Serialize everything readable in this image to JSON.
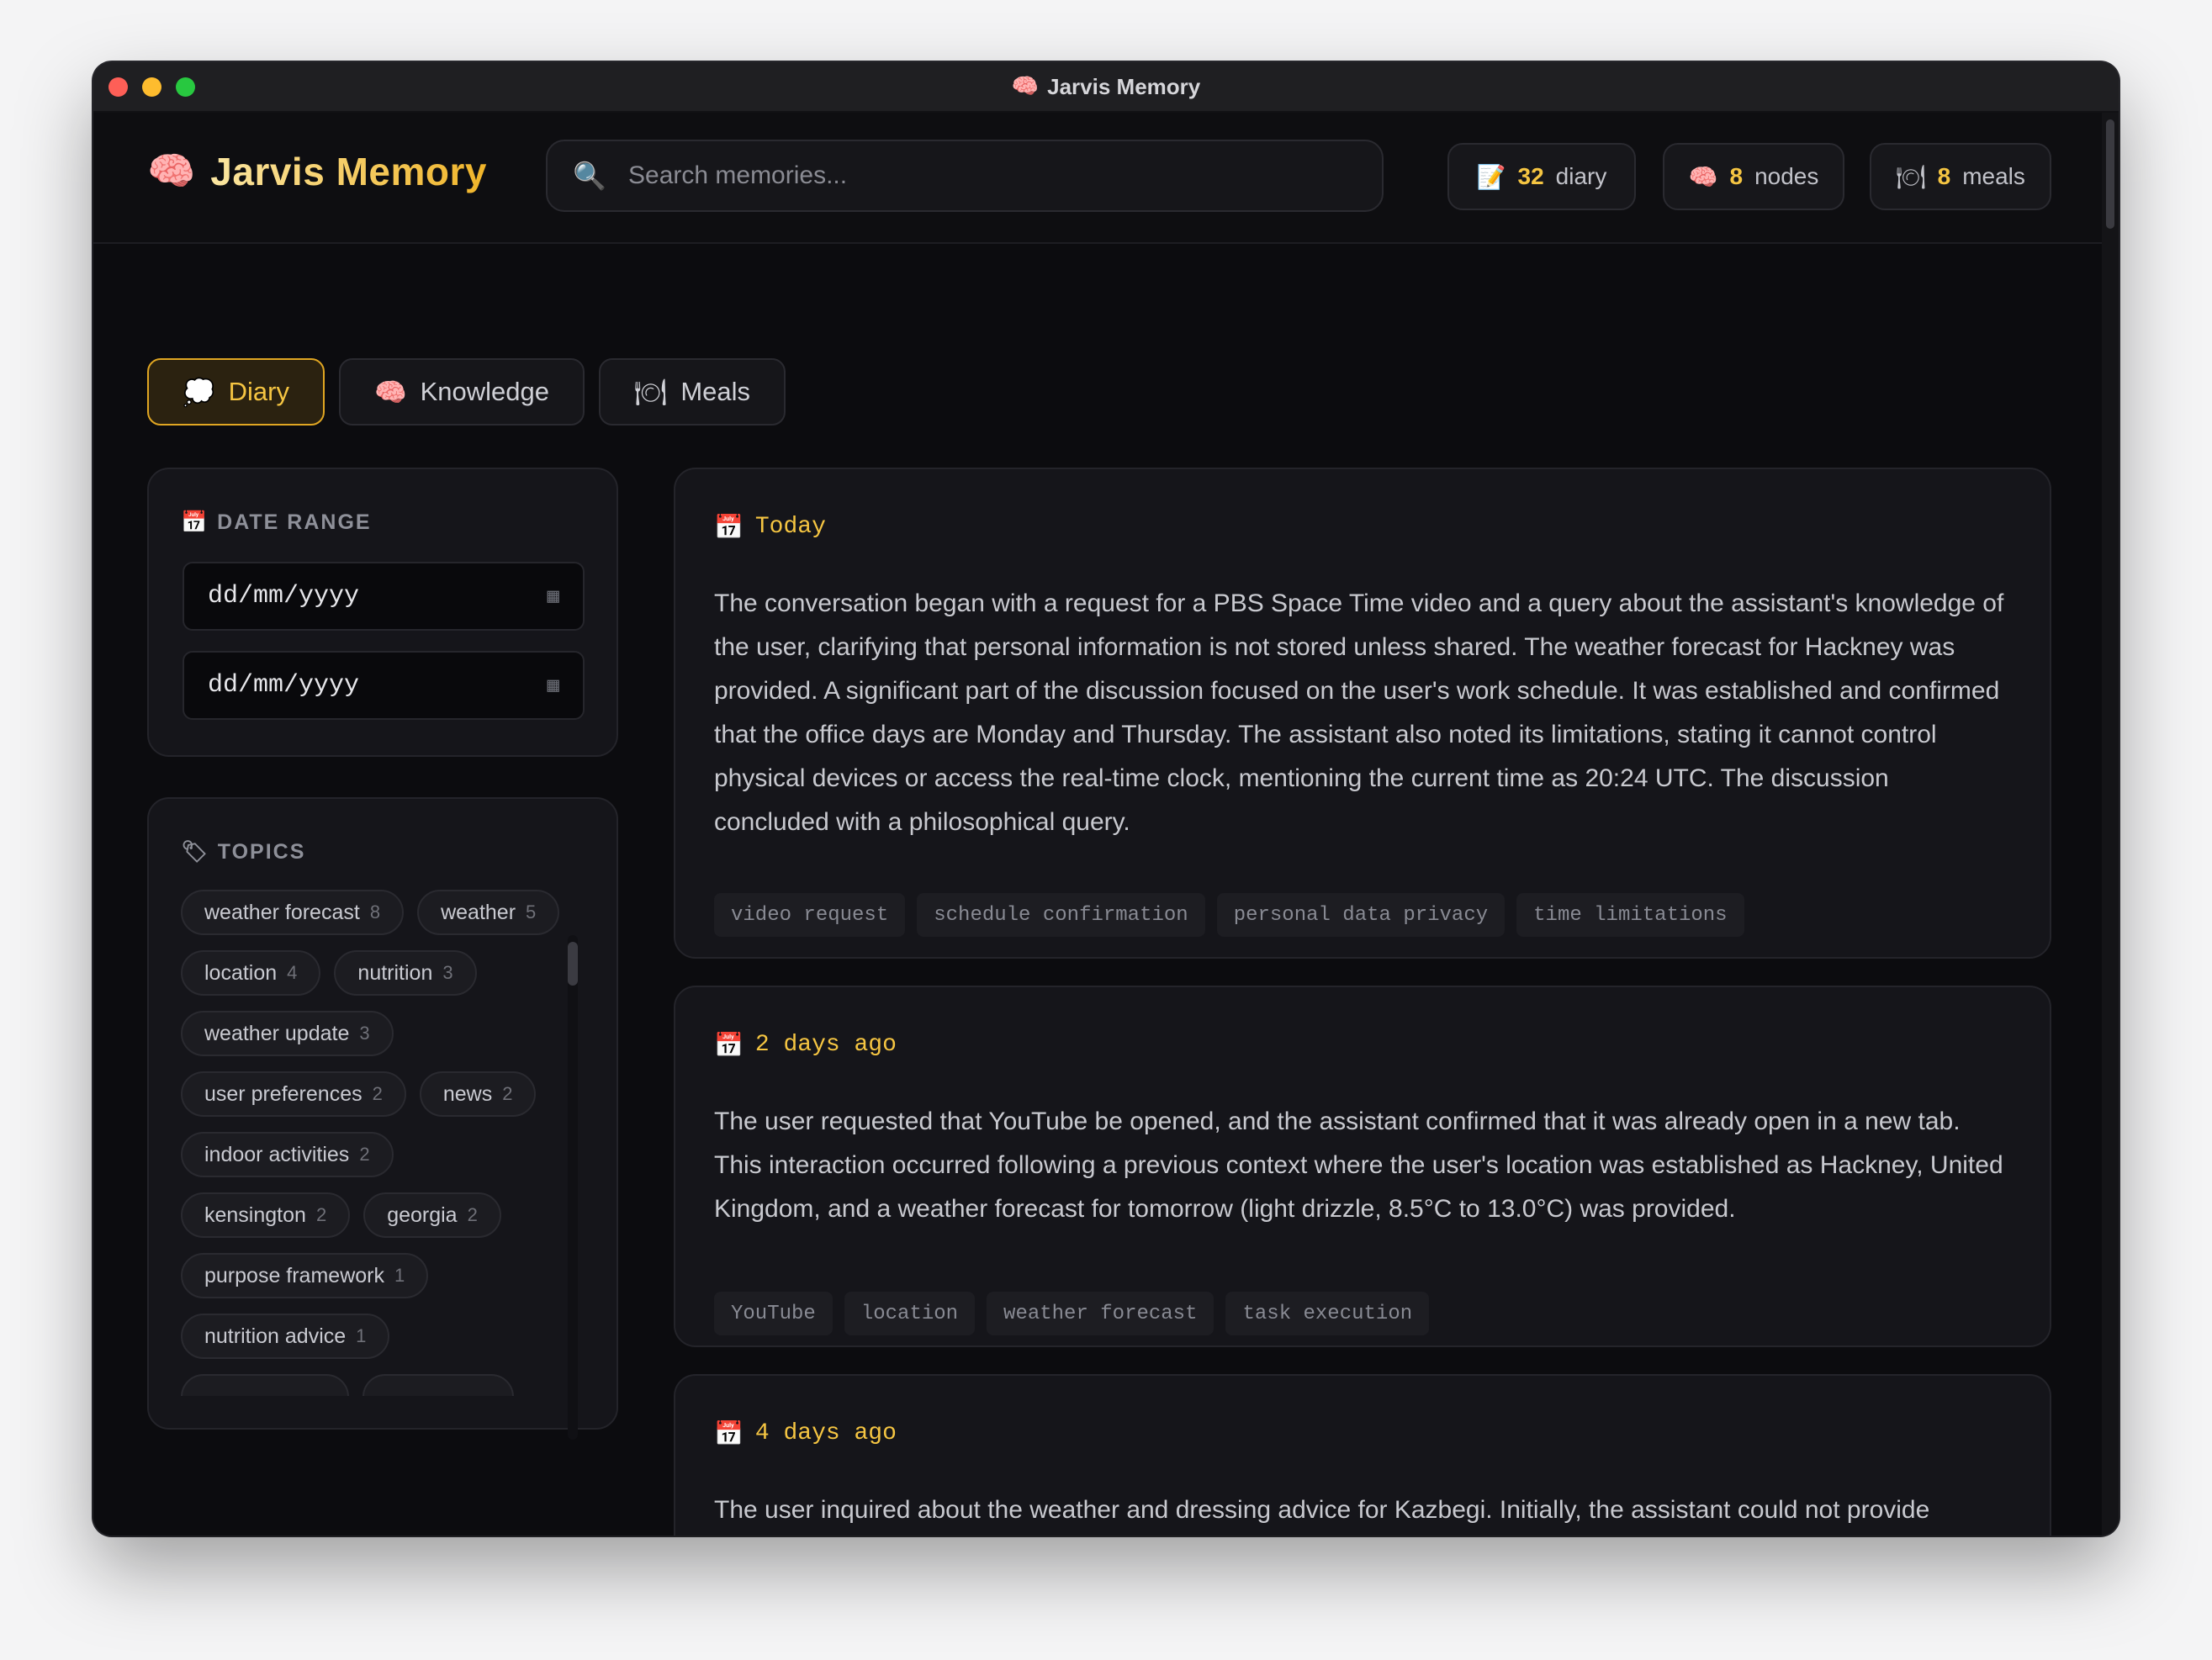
{
  "window": {
    "title": "Jarvis Memory",
    "title_icon": "brain-icon"
  },
  "header": {
    "app_name": "Jarvis Memory",
    "logo_icon": "🧠",
    "search": {
      "placeholder": "Search memories...",
      "icon": "🔍"
    },
    "stats": [
      {
        "icon": "📝",
        "count": "32",
        "label": "diary"
      },
      {
        "icon": "🧠",
        "count": "8",
        "label": "nodes"
      },
      {
        "icon": "🍽",
        "count": "8",
        "label": "meals"
      }
    ]
  },
  "tabs": [
    {
      "icon": "💭",
      "label": "Diary",
      "active": true
    },
    {
      "icon": "🧠",
      "label": "Knowledge",
      "active": false
    },
    {
      "icon": "🍽",
      "label": "Meals",
      "active": false
    }
  ],
  "sidebar": {
    "date_range": {
      "icon": "📅",
      "title": "DATE RANGE",
      "from_placeholder": "dd/mm/yyyy",
      "to_placeholder": "dd/mm/yyyy"
    },
    "topics": {
      "icon": "🏷",
      "title": "TOPICS",
      "rows": [
        [
          {
            "name": "weather forecast",
            "count": "8"
          },
          {
            "name": "weather",
            "count": "5"
          }
        ],
        [
          {
            "name": "location",
            "count": "4"
          },
          {
            "name": "nutrition",
            "count": "3"
          }
        ],
        [
          {
            "name": "weather update",
            "count": "3"
          }
        ],
        [
          {
            "name": "user preferences",
            "count": "2"
          },
          {
            "name": "news",
            "count": "2"
          }
        ],
        [
          {
            "name": "indoor activities",
            "count": "2"
          }
        ],
        [
          {
            "name": "kensington",
            "count": "2"
          },
          {
            "name": "georgia",
            "count": "2"
          }
        ],
        [
          {
            "name": "purpose framework",
            "count": "1"
          }
        ],
        [
          {
            "name": "nutrition advice",
            "count": "1"
          }
        ]
      ]
    }
  },
  "entries": [
    {
      "icon": "📅",
      "date": "Today",
      "text": "The conversation began with a request for a PBS Space Time video and a query about the assistant's knowledge of the user, clarifying that personal information is not stored unless shared. The weather forecast for Hackney was provided. A significant part of the discussion focused on the user's work schedule. It was established and confirmed that the office days are Monday and Thursday. The assistant also noted its limitations, stating it cannot control physical devices or access the real-time clock, mentioning the current time as 20:24 UTC. The discussion concluded with a philosophical query.",
      "tags": [
        "video request",
        "schedule confirmation",
        "personal data privacy",
        "time limitations"
      ]
    },
    {
      "icon": "📅",
      "date": "2 days ago",
      "text": "The user requested that YouTube be opened, and the assistant confirmed that it was already open in a new tab. This interaction occurred following a previous context where the user's location was established as Hackney, United Kingdom, and a weather forecast for tomorrow (light drizzle, 8.5°C to 13.0°C) was provided.",
      "tags": [
        "YouTube",
        "location",
        "weather forecast",
        "task execution"
      ]
    },
    {
      "icon": "📅",
      "date": "4 days ago",
      "text": "The user inquired about the weather and dressing advice for Kazbegi. Initially, the assistant could not provide specific forecasts. After the user prompted the assistant to check using the weather tool, the assistant found a forecast for Kazbegi, Georgia. The forecast indicates that it is expected to be a bit snowy with temperatures",
      "tags": []
    }
  ]
}
